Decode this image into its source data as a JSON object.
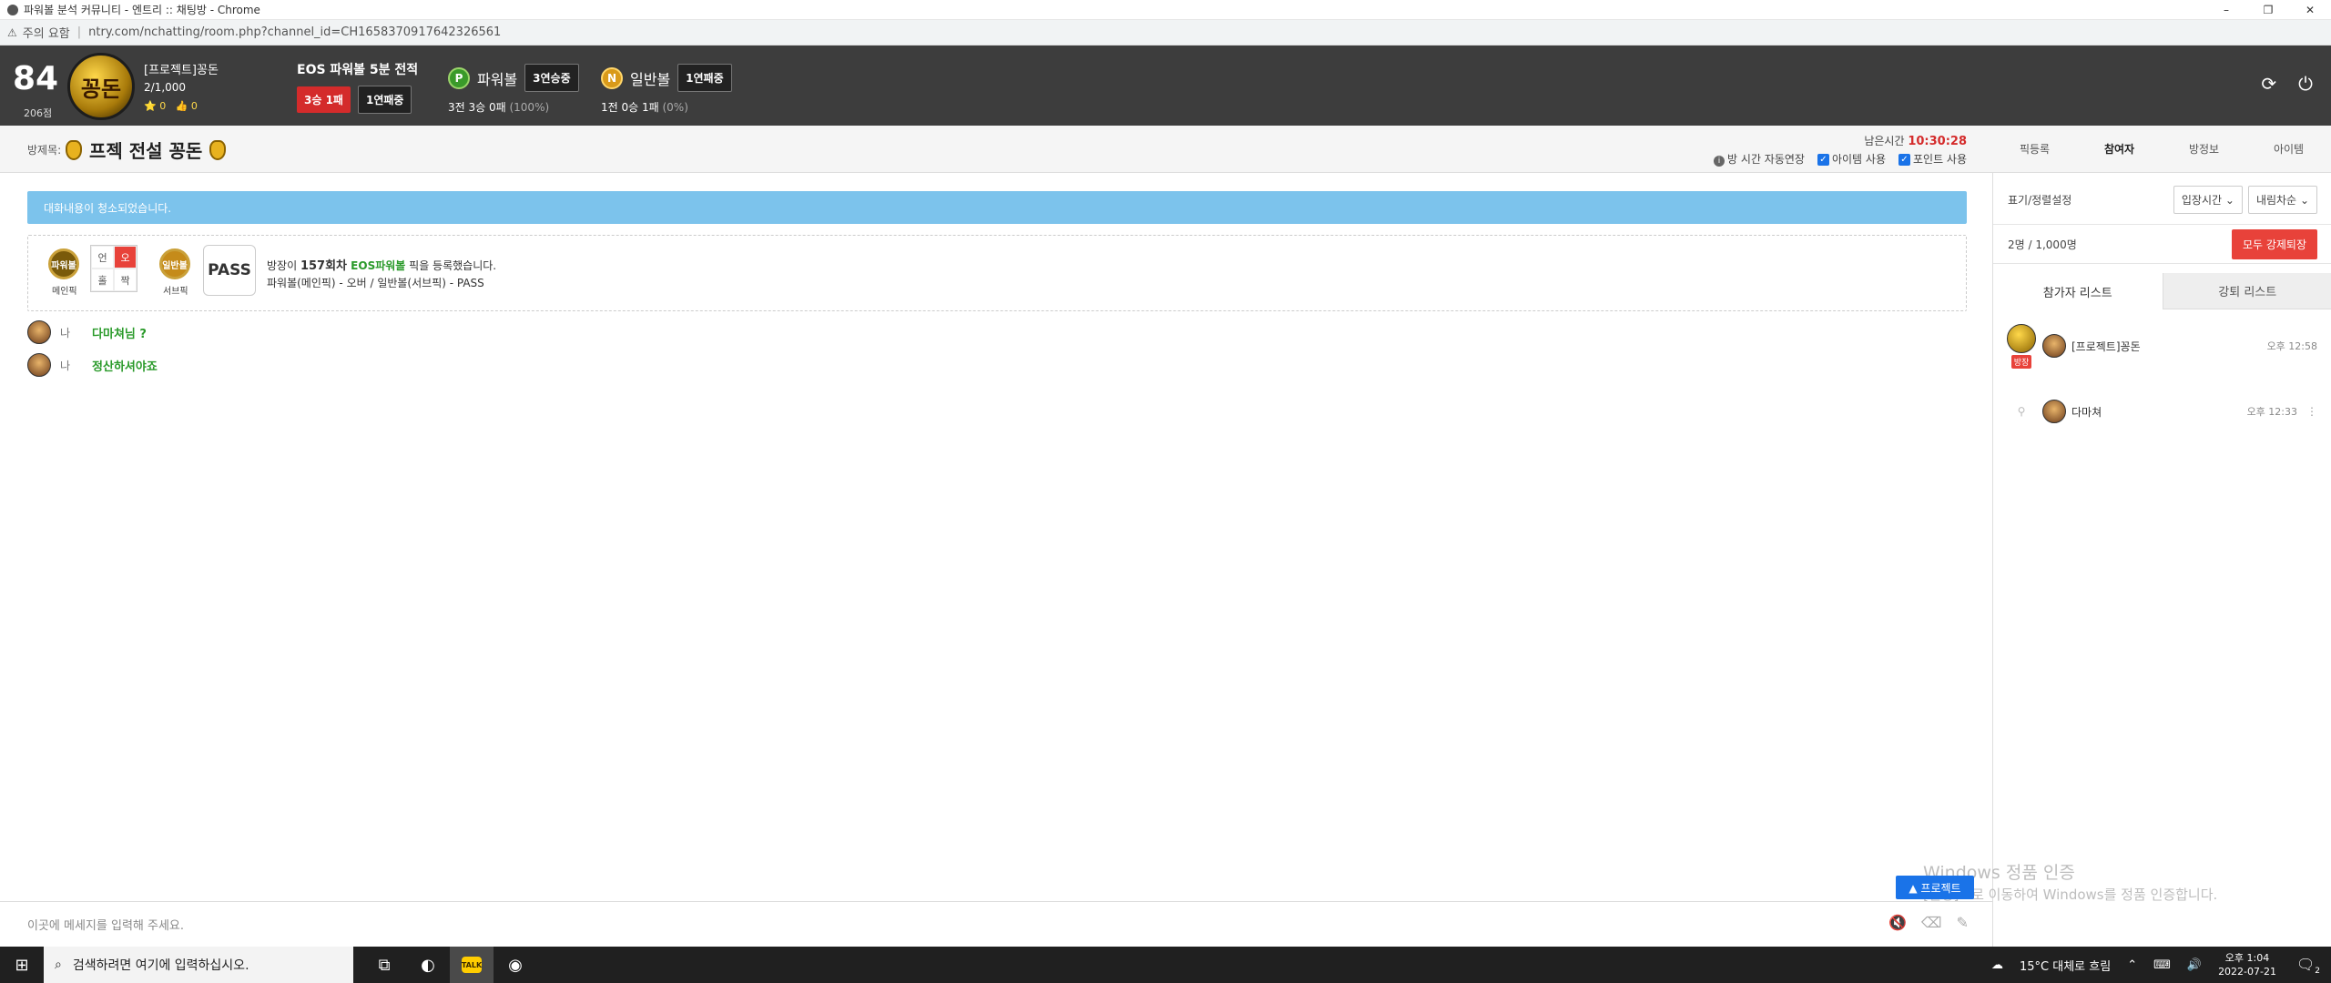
{
  "window": {
    "title": "파워볼 분석 커뮤니티 - 엔트리 :: 채팅방 - Chrome",
    "minimize": "–",
    "restore": "❐",
    "close": "✕"
  },
  "address": {
    "warning": "주의 요함",
    "url": "ntry.com/nchatting/room.php?channel_id=CH1658370917642326561"
  },
  "header": {
    "level": "84",
    "points": "206점",
    "badge_text": "꽁돈",
    "username": "[프로젝트]꽁돈",
    "count": "2/1,000",
    "stars": "⭐ 0",
    "likes": "👍 0",
    "eos_title": "EOS 파워볼 5분 전적",
    "eos_record": "3승 1패",
    "eos_streak": "1연패중",
    "pb_coin": "P",
    "pb_title": "파워볼",
    "pb_streak": "3연승중",
    "pb_record": "3전 3승 0패",
    "pb_rate": "(100%)",
    "nb_coin": "N",
    "nb_title": "일반볼",
    "nb_streak": "1연패중",
    "nb_record": "1전 0승 1패",
    "nb_rate": "(0%)",
    "refresh_icon": "⟳",
    "power_icon": "⏻"
  },
  "room": {
    "label": "방제목:",
    "title": "프젝 전설 꽁돈",
    "remain_label": "남은시간",
    "remain_time": "10:30:28",
    "opt_extend": "방 시간 자동연장",
    "opt_item": "아이템 사용",
    "opt_point": "포인트 사용"
  },
  "right_tabs": [
    "픽등록",
    "참여자",
    "방정보",
    "아이템"
  ],
  "right_panel": {
    "sort_label": "표기/정렬설정",
    "sort_select": "입장시간",
    "order_select": "내림차순",
    "count": "2명 / 1,000명",
    "kick_all": "모두 강제퇴장",
    "tab_participants": "참가자 리스트",
    "tab_kicked": "강퇴 리스트",
    "participants": [
      {
        "name": "[프로젝트]꽁돈",
        "tag": "방장",
        "time": "오후 12:58"
      },
      {
        "name": "다마쳐",
        "tag": "",
        "time": "오후 12:33"
      }
    ]
  },
  "chat": {
    "notice": "대화내용이 청소되었습니다.",
    "pick": {
      "main_badge": "파워볼",
      "main_label": "메인픽",
      "grid": [
        "언",
        "오",
        "홀",
        "짝"
      ],
      "sub_badge": "일반볼",
      "sub_label": "서브픽",
      "pass": "PASS",
      "line1_a": "방장이 ",
      "line1_round": "157회차",
      "line1_b": " EOS파워볼",
      "line1_c": " 픽을 등록했습니다.",
      "line2": "파워볼(메인픽) - 오버 / 일반볼(서브픽) - PASS"
    },
    "messages": [
      {
        "who": "나",
        "text": "다마쳐님 ?"
      },
      {
        "who": "나",
        "text": "정산하셔야죠"
      }
    ],
    "input_placeholder": "이곳에 메세지를 입력해 주세요.",
    "project_btn": "▲ 프로젝트"
  },
  "watermark": {
    "line1": "Windows 정품 인증",
    "line2": "[설정]으로 이동하여 Windows를 정품 인증합니다."
  },
  "taskbar": {
    "search_placeholder": "검색하려면 여기에 입력하십시오.",
    "weather": "15°C 대체로 흐림",
    "time": "오후 1:04",
    "date": "2022-07-21",
    "kakao": "TALK",
    "notif_count": "2"
  }
}
